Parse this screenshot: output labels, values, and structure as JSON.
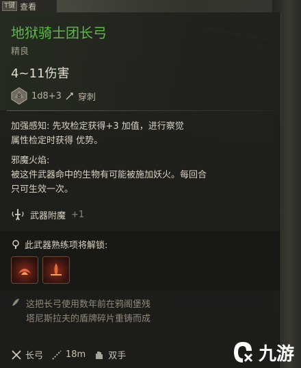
{
  "header": {
    "key": "T键",
    "label": "查看"
  },
  "item": {
    "name": "地狱骑士团长弓",
    "rarity": "精良",
    "damage": "4~11伤害",
    "die_face": "8",
    "dice": "1d8+3",
    "damage_type": "穿刺"
  },
  "features": {
    "line1": "加强感知: 先攻检定获得+3 加值，进行察觉",
    "line2": "属性检定时获得 优势。",
    "hellfire_title": "邪魔火焰:",
    "hellfire_line1": "被这件武器命中的生物有可能被施加妖火。每回合",
    "hellfire_line2": "只可生效一次。"
  },
  "enchantment": {
    "label": "武器附魔",
    "value": "+1"
  },
  "proficiency": {
    "label": "此武器熟练项将解锁:"
  },
  "lore": {
    "line1": "这把长弓使用数年前在鸦阁堡残",
    "line2": "塔尼斯拉夫的盾牌碎片重铸而成"
  },
  "stats": {
    "type": "长弓",
    "range": "18m",
    "hands": "双手"
  },
  "watermark": {
    "text": "九游"
  },
  "colors": {
    "title": "#5fb84a",
    "accent_red": "#8a2a1a"
  }
}
